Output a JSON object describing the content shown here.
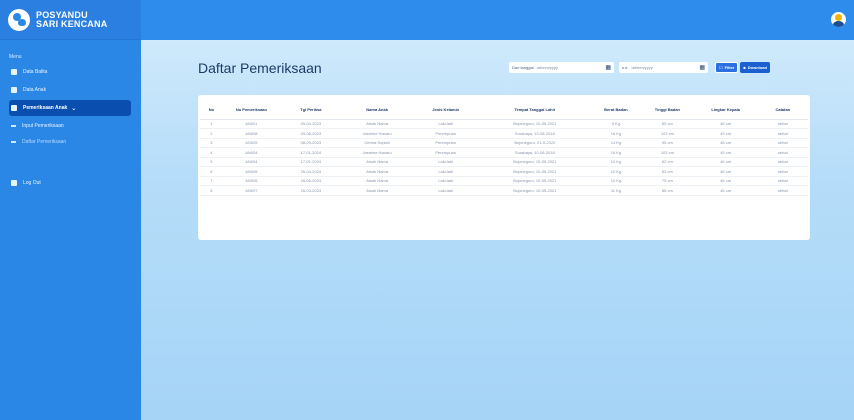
{
  "app": {
    "brand_line1": "POSYANDU",
    "brand_line2": "SARI KENCANA"
  },
  "sidebar": {
    "heading": "Menu",
    "items": [
      {
        "label": "Data Balita",
        "icon": "database-icon"
      },
      {
        "label": "Data Anak",
        "icon": "child-icon"
      },
      {
        "label": "Pemeriksaan Anak",
        "icon": "clipboard-icon",
        "active": true,
        "chevron": "⌄"
      }
    ],
    "subitems": [
      {
        "label": "Input Pemeriksaan"
      },
      {
        "label": "Daftar Pemeriksaan"
      }
    ],
    "logout": {
      "label": "Log Out",
      "icon": "logout-icon"
    }
  },
  "topbar": {
    "avatar": "user-avatar-icon"
  },
  "main": {
    "title": "Daftar Pemeriksaan",
    "filters": {
      "start_label": "Dari tanggal",
      "start_placeholder": "dd/mm/yyyy",
      "end_label": "s.d.",
      "end_placeholder": "dd/mm/yyyy",
      "filter_button": "Filter",
      "download_button": "Download"
    },
    "table": {
      "headers": [
        "No",
        "No Pemeriksaan",
        "Tgl Periksa",
        "Nama Anak",
        "Jenis Kelamin",
        "Tempat Tanggal Lahir",
        "Berat Badan",
        "Tinggi Badan",
        "Lingkar Kepala",
        "Catatan"
      ],
      "rows": [
        [
          "1",
          "AN001",
          "05-04-2023",
          "Aisah Nama",
          "Laki-laki",
          "Bojonegoro, 10-05-2021",
          "9 Kg",
          "80 cm",
          "46 cm",
          "sehat"
        ],
        [
          "2",
          "AN008",
          "09-08-2023",
          "Jasmine Hanaru",
          "Perempuan",
          "Surabaya, 10-08-2018",
          "16 Kg",
          "103 cm",
          "49 cm",
          "sehat"
        ],
        [
          "3",
          "AN009",
          "08-09-2023",
          "Gerina Sopiah",
          "Perempuan",
          "Bojonegoro, 21-9-2020",
          "14 Kg",
          "95 cm",
          "48 cm",
          "sehat"
        ],
        [
          "4",
          "AN004",
          "17-01-2024",
          "Jasmine Hanaru",
          "Perempuan",
          "Surabaya, 10-08-2018",
          "16 Kg",
          "103 cm",
          "49 cm",
          "sehat"
        ],
        [
          "5",
          "AN004",
          "17-01-2024",
          "Aisah Nama",
          "Laki-laki",
          "Bojonegoro, 10-05-2021",
          "10 Kg",
          "82 cm",
          "46 cm",
          "sehat"
        ],
        [
          "6",
          "AN005",
          "26-04-2024",
          "Aisah Nama",
          "Laki-laki",
          "Bojonegoro, 10-05-2021",
          "10 Kg",
          "83 cm",
          "46 cm",
          "sehat"
        ],
        [
          "7",
          "AN005",
          "26-06-2024",
          "Aisah Nama",
          "Laki-laki",
          "Bojonegoro, 10-05-2021",
          "10 Kg",
          "75 cm",
          "46 cm",
          "sehat"
        ],
        [
          "8",
          "AN007",
          "26-03-2024",
          "Aisah Nama",
          "Laki-laki",
          "Bojonegoro, 10-05-2021",
          "11 Kg",
          "86 cm",
          "46 cm",
          "sehat"
        ]
      ]
    }
  },
  "colors": {
    "sidebar_bg": "#2b87e6",
    "topbar_bg": "#2e8cec",
    "active_item": "#0a4fb0",
    "content_bg": "#b6ddf9",
    "button_bg": "#1b5fd1",
    "title": "#1f3a66"
  }
}
